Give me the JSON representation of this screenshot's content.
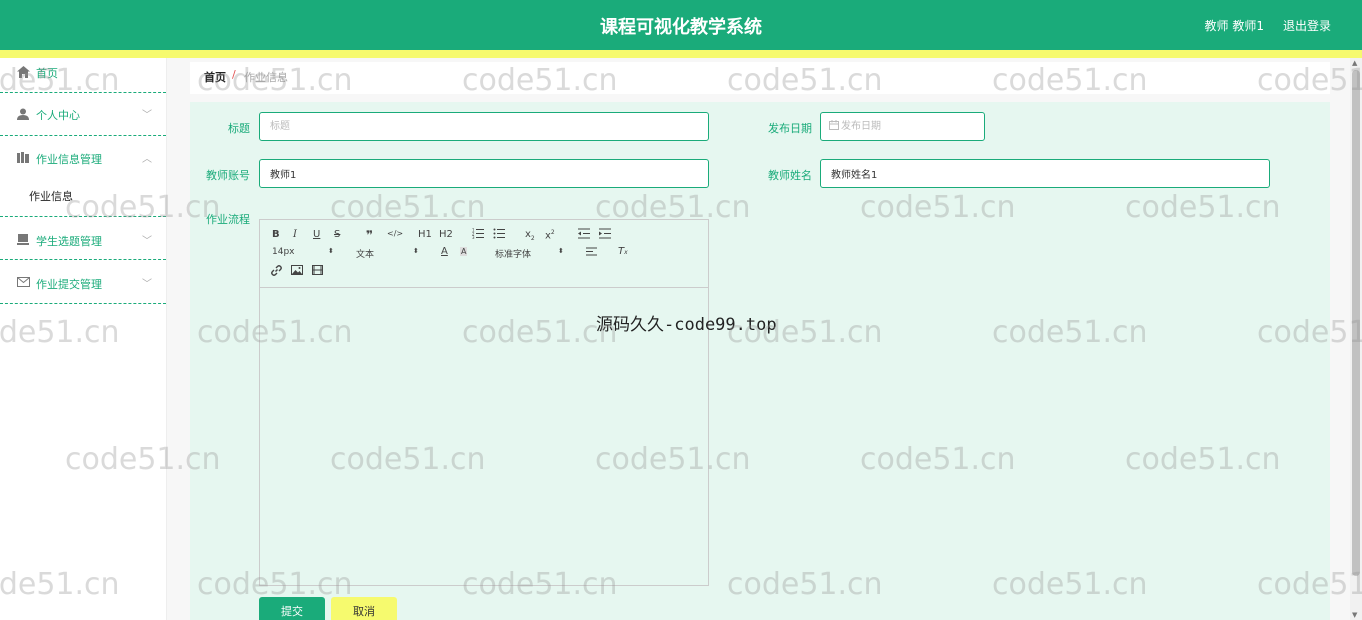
{
  "header": {
    "title": "课程可视化教学系统",
    "user": "教师 教师1",
    "logout": "退出登录"
  },
  "sidebar": {
    "items": [
      {
        "label": "首页",
        "icon": "home-icon"
      },
      {
        "label": "个人中心",
        "icon": "user-icon"
      },
      {
        "label": "作业信息管理",
        "icon": "book-icon"
      },
      {
        "label": "作业信息"
      },
      {
        "label": "学生选题管理",
        "icon": "topic-icon"
      },
      {
        "label": "作业提交管理",
        "icon": "mail-icon"
      }
    ]
  },
  "breadcrumb": {
    "home": "首页",
    "separator": "/",
    "current": "作业信息"
  },
  "form": {
    "title_label": "标题",
    "title_placeholder": "标题",
    "date_label": "发布日期",
    "date_placeholder": "发布日期",
    "teacher_account_label": "教师账号",
    "teacher_account_value": "教师1",
    "teacher_name_label": "教师姓名",
    "teacher_name_value": "教师姓名1",
    "process_label": "作业流程"
  },
  "editor": {
    "font_size": "14px",
    "format": "文本",
    "font_family": "标准字体",
    "h1": "H1",
    "h2": "H2"
  },
  "buttons": {
    "submit": "提交",
    "cancel": "取消"
  },
  "promo": "源码久久-code99.top",
  "watermark": "code51.cn",
  "colors": {
    "primary": "#1aab7a",
    "accent": "#f6fa6e",
    "form_bg": "#e6f7f0"
  }
}
